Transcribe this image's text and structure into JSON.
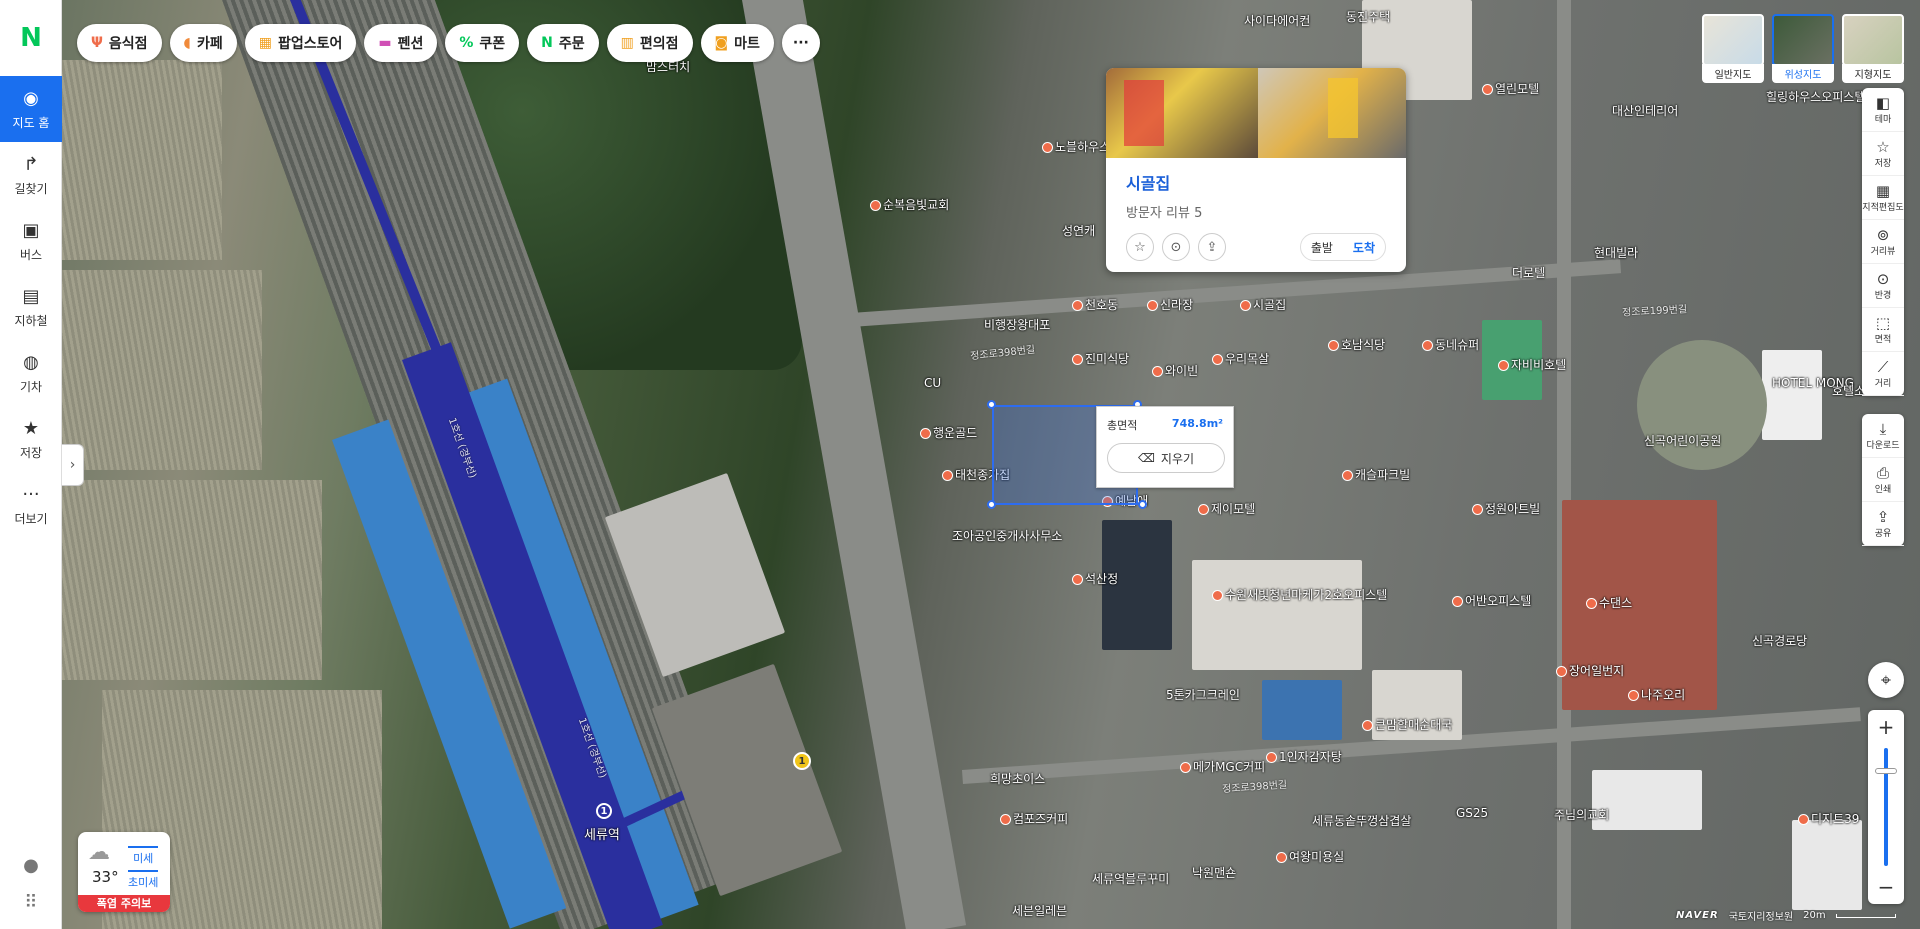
{
  "brand": "N",
  "nav": {
    "items": [
      {
        "label": "지도 홈",
        "icon": "map-pin-icon"
      },
      {
        "label": "길찾기",
        "icon": "directions-icon"
      },
      {
        "label": "버스",
        "icon": "bus-icon"
      },
      {
        "label": "지하철",
        "icon": "subway-icon"
      },
      {
        "label": "기차",
        "icon": "train-icon"
      },
      {
        "label": "저장",
        "icon": "star-icon"
      },
      {
        "label": "더보기",
        "icon": "more-icon"
      }
    ]
  },
  "chips": [
    {
      "label": "음식점",
      "icon": "utensils-icon",
      "color": "#ef6c4a"
    },
    {
      "label": "카페",
      "icon": "cup-icon",
      "color": "#f08a3a"
    },
    {
      "label": "팝업스토어",
      "icon": "store-icon",
      "color": "#f0a020"
    },
    {
      "label": "펜션",
      "icon": "bed-icon",
      "color": "#d04fb5"
    },
    {
      "label": "쿠폰",
      "icon": "coupon-icon",
      "color": "#03c75a"
    },
    {
      "label": "주문",
      "icon": "naver-order-icon",
      "color": "#03c75a"
    },
    {
      "label": "편의점",
      "icon": "convenience-icon",
      "color": "#f0a020"
    },
    {
      "label": "마트",
      "icon": "cart-icon",
      "color": "#f0a020"
    }
  ],
  "place": {
    "name": "시골집",
    "reviews": "방문자 리뷰 5",
    "start": "출발",
    "dest": "도착"
  },
  "area": {
    "label": "총면적",
    "value": "748.8m²",
    "erase": "지우기"
  },
  "maptypes": [
    {
      "label": "일반지도",
      "active": false
    },
    {
      "label": "위성지도",
      "active": true
    },
    {
      "label": "지형지도",
      "active": false
    }
  ],
  "tools": [
    {
      "label": "테마",
      "icon": "layers-icon"
    },
    {
      "label": "저장",
      "icon": "star-icon"
    },
    {
      "label": "지적편집도",
      "icon": "cadastral-icon"
    },
    {
      "label": "거리뷰",
      "icon": "streetview-icon"
    },
    {
      "label": "반경",
      "icon": "radius-icon"
    },
    {
      "label": "면적",
      "icon": "area-icon"
    },
    {
      "label": "거리",
      "icon": "ruler-icon"
    }
  ],
  "tools2": [
    {
      "label": "다운로드",
      "icon": "download-icon"
    },
    {
      "label": "인쇄",
      "icon": "print-icon"
    },
    {
      "label": "공유",
      "icon": "share-icon"
    }
  ],
  "weather": {
    "temp": "33°",
    "dust1": "미세",
    "dust2": "초미세",
    "alert": "폭염 주의보"
  },
  "scale": {
    "brand": "NAVER",
    "source": "국토지리정보원",
    "distance": "20m"
  },
  "map_labels": {
    "pois": [
      "시골집",
      "비행장왕대포",
      "천호동",
      "신라장",
      "진미식당",
      "와이빈",
      "우리목살",
      "행운골드",
      "태천종가집",
      "조아공인중개사사무소",
      "예남애",
      "제이모텔",
      "석산정",
      "캐슬파크빌",
      "정원아트빌",
      "순복음빛교회",
      "노블하우스",
      "성연캐",
      "수원새빛청년마케가2호오피스텔",
      "어반오피스텔",
      "5톤카그크레인",
      "메가MGC커피",
      "1인자감자탕",
      "큰맘할매순대국",
      "희망초이스",
      "컴포즈커피",
      "여왕미용실",
      "낙원맨숀",
      "세류역블루꾸미",
      "세븐일레븐",
      "세류동솥뚜껑삼겹살",
      "GS25",
      "주님의교회",
      "나주오리",
      "장어일번지",
      "수댄스",
      "신곡경로당",
      "사이다에어컨",
      "동진주택",
      "열린모텔",
      "대산인테리어",
      "힐링하우스오피스텔",
      "현대빌라",
      "자비비호텔",
      "동네슈퍼",
      "호남식당",
      "더로텔",
      "HOTEL MONG",
      "호텔소",
      "신곡어린이공원",
      "디지트39",
      "CU",
      "맘스터치"
    ],
    "station": "세류역",
    "station_no": "1",
    "exit_no": "1",
    "line_label": "1호선 (경부선)",
    "road_label": "정조로398번길",
    "road_label2": "정조로199번길"
  }
}
